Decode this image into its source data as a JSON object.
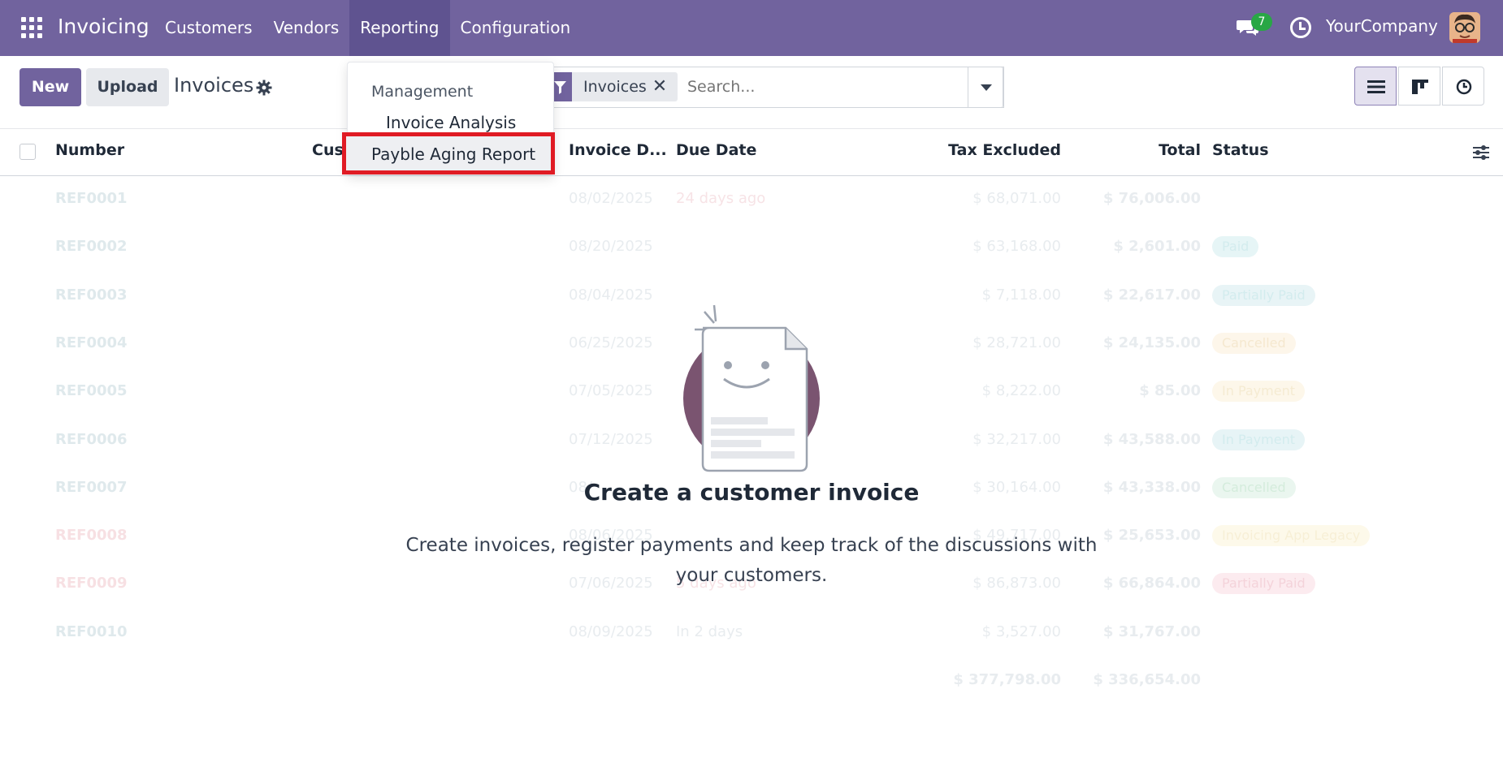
{
  "app": {
    "name": "Invoicing"
  },
  "topnav": [
    "Customers",
    "Vendors",
    "Reporting",
    "Configuration"
  ],
  "topright": {
    "message_count": "7",
    "company": "YourCompany"
  },
  "controls": {
    "new_label": "New",
    "upload_label": "Upload",
    "title": "Invoices"
  },
  "search": {
    "facet": "Invoices",
    "remove": "✕",
    "placeholder": "Search..."
  },
  "table": {
    "columns": {
      "number": "Number",
      "customer": "Cus",
      "invoice_date": "Invoice D...",
      "due_date": "Due Date",
      "tax_excluded": "Tax Excluded",
      "total": "Total",
      "status": "Status"
    },
    "rows": [
      {
        "number": "REF0001",
        "date": "08/02/2025",
        "due": "24 days ago",
        "tax": "$ 68,071.00",
        "total": "$ 76,006.00",
        "status": ""
      },
      {
        "number": "REF0002",
        "date": "08/20/2025",
        "due": "",
        "tax": "$ 63,168.00",
        "total": "$ 2,601.00",
        "status": "Paid"
      },
      {
        "number": "REF0003",
        "date": "08/04/2025",
        "due": "",
        "tax": "$ 7,118.00",
        "total": "$ 22,617.00",
        "status": "Partially Paid"
      },
      {
        "number": "REF0004",
        "date": "06/25/2025",
        "due": "",
        "tax": "$ 28,721.00",
        "total": "$ 24,135.00",
        "status": "Cancelled"
      },
      {
        "number": "REF0005",
        "date": "07/05/2025",
        "due": "",
        "tax": "$ 8,222.00",
        "total": "$ 85.00",
        "status": "In Payment"
      },
      {
        "number": "REF0006",
        "date": "07/12/2025",
        "due": "",
        "tax": "$ 32,217.00",
        "total": "$ 43,588.00",
        "status": "In Payment"
      },
      {
        "number": "REF0007",
        "date": "08/",
        "due": "",
        "tax": "$ 30,164.00",
        "total": "$ 43,338.00",
        "status": "Cancelled"
      },
      {
        "number": "REF0008",
        "date": "08/06/2025",
        "due": "",
        "tax": "$ 49,717.00",
        "total": "$ 25,653.00",
        "status": "Invoicing App Legacy"
      },
      {
        "number": "REF0009",
        "date": "07/06/2025",
        "due": "5 days ago",
        "tax": "$ 86,873.00",
        "total": "$ 66,864.00",
        "status": "Partially Paid"
      },
      {
        "number": "REF0010",
        "date": "08/09/2025",
        "due": "In 2 days",
        "tax": "$ 3,527.00",
        "total": "$ 31,767.00",
        "status": ""
      }
    ],
    "totals": {
      "tax": "$ 377,798.00",
      "total": "$ 336,654.00"
    }
  },
  "empty_state": {
    "title": "Create a customer invoice",
    "description": "Create invoices, register payments and keep track of the discussions with your customers."
  },
  "reporting_menu": {
    "section": "Management",
    "items": [
      "Invoice Analysis",
      "Payble Aging Report"
    ]
  },
  "colors": {
    "brand": "#71639e",
    "highlight": "#e01b24"
  }
}
